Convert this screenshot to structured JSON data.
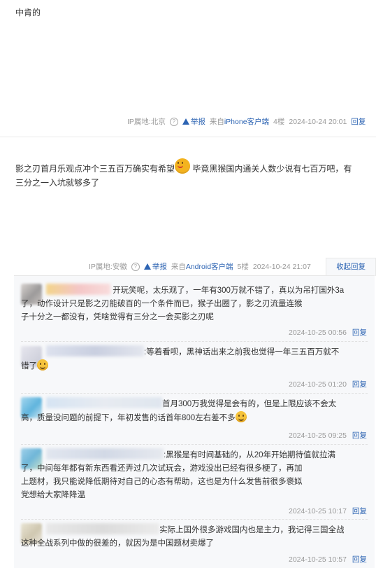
{
  "post1": {
    "text": "中肯的",
    "meta": {
      "ip": "IP属地:北京",
      "report": "举报",
      "source_prefix": "来自",
      "source_link": "iPhone客户端",
      "floor": "4楼",
      "time": "2024-10-24 20:01",
      "reply": "回复"
    }
  },
  "post2": {
    "text_a": "影之刃首月乐观点冲个三五百万确实有希望",
    "text_b": "毕竟黑猴国内通关人数少说有七百万吧，有",
    "text_c": "三分之一入坑就够多了",
    "meta": {
      "ip": "IP属地:安徽",
      "report": "举报",
      "source_prefix": "来自",
      "source_link": "Android客户端",
      "floor": "5楼",
      "time": "2024-10-24 21:07",
      "collapse": "收起回复"
    }
  },
  "replies": [
    {
      "line1": "开玩笑呢，太乐观了，一年有300万就不错了，真以为吊打国外3a",
      "line2": "了，动作设计只是影之刃能破百的一个条件而已，猴子出圈了，影之刃流量连猴",
      "line3": "子十分之一都没有，凭啥觉得有三分之一会买影之刃呢",
      "time": "2024-10-25 00:56",
      "reply": "回复"
    },
    {
      "line1": ":等着看呗，黑神话出来之前我也觉得一年三五百万就不",
      "line2": "错了",
      "time": "2024-10-25 01:20",
      "reply": "回复"
    },
    {
      "line1": "首月300万我觉得是会有的，但是上限应该不会太",
      "line2": "高，质量没问题的前提下，年初发售的话首年800左右差不多",
      "time": "2024-10-25 09:25",
      "reply": "回复"
    },
    {
      "line1": ":黑猴是有时间基础的，从20年开始期待值就拉满",
      "line2": "了，中间每年都有新东西看还弄过几次试玩会，游戏没出已经有很多梗了，再加",
      "line3": "上题材，我只能说降低期待对自己的心态有帮助，这也是为什么发售前很多褒姒",
      "line4": "党想给大家降降温",
      "time": "2024-10-25 10:17",
      "reply": "回复"
    },
    {
      "line1": "实际上国外很多游戏国内也是主力，我记得三国全战",
      "line2": "这种全战系列中做的很差的，就因为是中国题材卖爆了",
      "time": "2024-10-25 10:57",
      "reply": "回复"
    }
  ]
}
